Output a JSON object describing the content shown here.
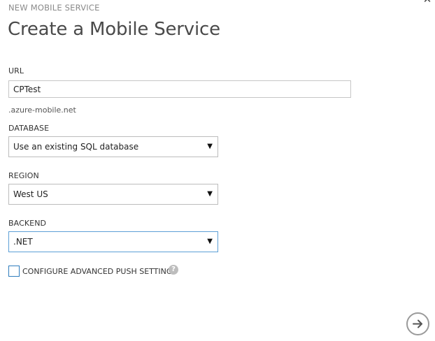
{
  "wizard": {
    "step_label": "NEW MOBILE SERVICE",
    "title": "Create a Mobile Service",
    "close_icon": "close-icon"
  },
  "url_field": {
    "label": "URL",
    "value": "CPTest",
    "suffix": ".azure-mobile.net"
  },
  "database": {
    "label": "DATABASE",
    "selected": "Use an existing SQL database"
  },
  "region": {
    "label": "REGION",
    "selected": "West US"
  },
  "backend": {
    "label": "BACKEND",
    "selected": ".NET"
  },
  "push_settings": {
    "label": "CONFIGURE ADVANCED PUSH SETTINGS",
    "checked": false,
    "help_icon": "?"
  },
  "navigation": {
    "next_icon": "arrow-right-icon"
  },
  "colors": {
    "focus_border": "#5c9fd6",
    "checkbox_border": "#2f7dbd",
    "title_text": "#4a4a4a"
  }
}
